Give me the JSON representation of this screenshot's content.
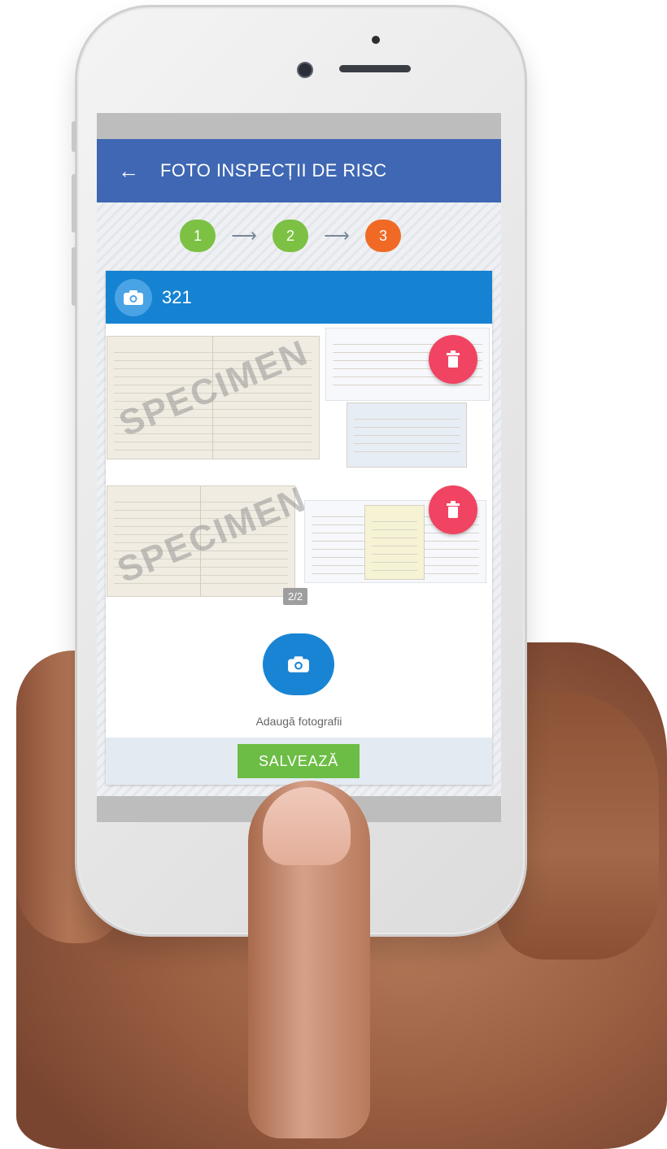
{
  "app_bar": {
    "back_icon": "arrow-left-icon",
    "title": "FOTO INSPECȚII DE RISC"
  },
  "stepper": {
    "steps": [
      {
        "label": "1",
        "status": "done",
        "color": "#7cc143"
      },
      {
        "label": "2",
        "status": "done",
        "color": "#7cc143"
      },
      {
        "label": "3",
        "status": "active",
        "color": "#f06a25"
      }
    ]
  },
  "card": {
    "header_icon": "camera-icon",
    "title": "321",
    "photos": [
      {
        "watermark": "SPECIMEN",
        "delete_icon": "trash-icon"
      },
      {
        "watermark": "SPECIMEN",
        "counter": "2/2",
        "delete_icon": "trash-icon"
      }
    ],
    "add_photo_icon": "camera-icon",
    "add_photo_label": "Adaugă fotografii",
    "save_label": "SALVEAZĂ"
  },
  "colors": {
    "app_bar": "#3f67b3",
    "card_header": "#1583d2",
    "step_done": "#7cc143",
    "step_active": "#f06a25",
    "delete": "#f04462",
    "save": "#6cbd45"
  }
}
